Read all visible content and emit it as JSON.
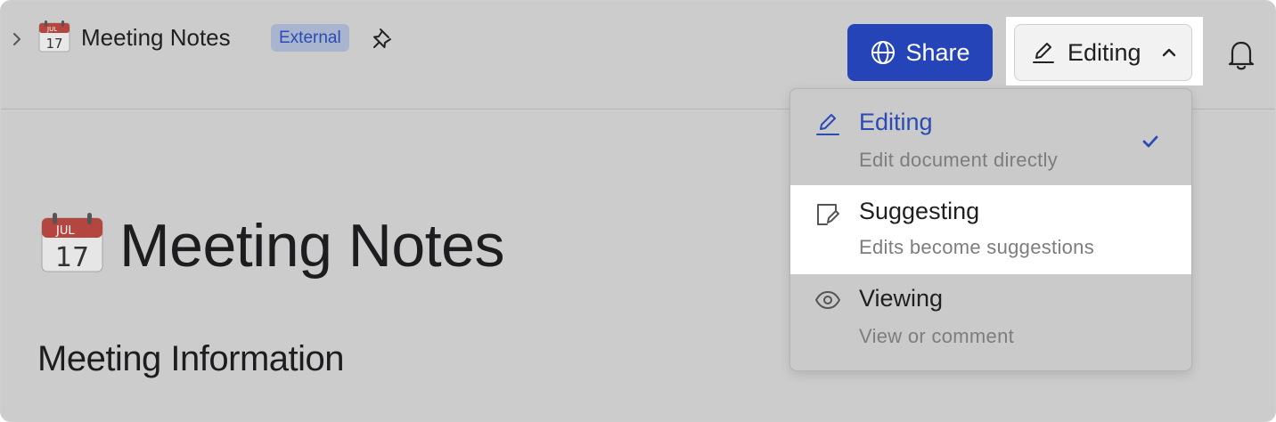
{
  "header": {
    "doc_title": "Meeting Notes",
    "badge": "External",
    "share_label": "Share",
    "mode_label": "Editing"
  },
  "page": {
    "title": "Meeting Notes",
    "section_heading": "Meeting Information"
  },
  "calendar_icon": {
    "month": "JUL",
    "day": "17"
  },
  "mode_menu": {
    "selected": "Editing",
    "options": [
      {
        "label": "Editing",
        "description": "Edit document directly",
        "icon": "pencil-icon"
      },
      {
        "label": "Suggesting",
        "description": "Edits become suggestions",
        "icon": "suggest-edit-icon"
      },
      {
        "label": "Viewing",
        "description": "View or comment",
        "icon": "eye-icon"
      }
    ]
  },
  "colors": {
    "accent": "#2444b8",
    "selected_text": "#2a4bb5",
    "overlay": "#cccccc"
  }
}
